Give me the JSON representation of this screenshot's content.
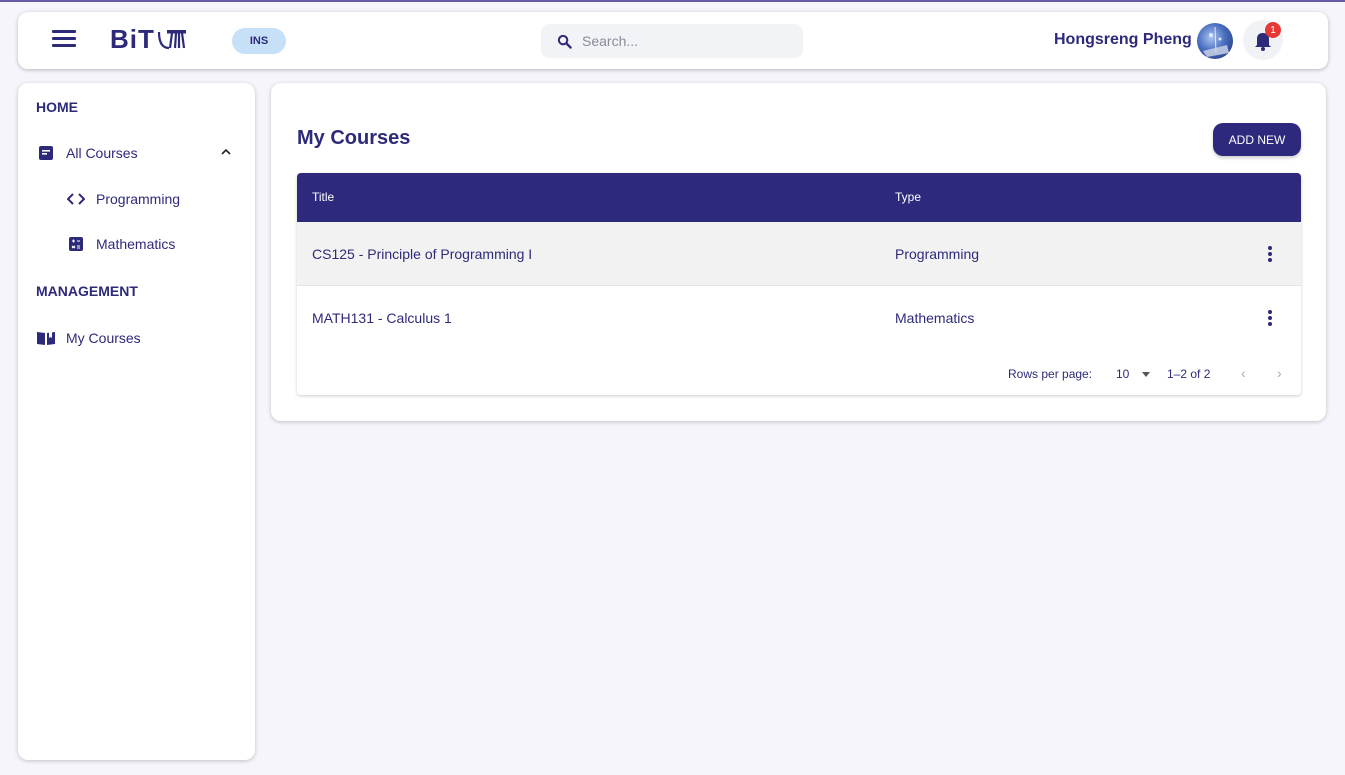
{
  "header": {
    "logo_text": "BiT",
    "role_badge": "INS",
    "search_placeholder": "Search...",
    "username": "Hongsreng Pheng",
    "notification_count": "1"
  },
  "sidebar": {
    "home_heading": "HOME",
    "all_courses_label": "All Courses",
    "sub_items": [
      {
        "label": "Programming",
        "icon": "code-icon"
      },
      {
        "label": "Mathematics",
        "icon": "calculator-icon"
      }
    ],
    "management_heading": "MANAGEMENT",
    "my_courses_label": "My Courses"
  },
  "main": {
    "title": "My Courses",
    "add_button": "ADD NEW",
    "columns": [
      "Title",
      "Type"
    ],
    "rows": [
      {
        "title": "CS125 - Principle of Programming I",
        "type": "Programming"
      },
      {
        "title": "MATH131 - Calculus 1",
        "type": "Mathematics"
      }
    ],
    "pagination": {
      "rows_per_page_label": "Rows per page:",
      "rows_per_page_value": "10",
      "range": "1–2 of 2"
    }
  },
  "colors": {
    "primary": "#2d2a7e",
    "badge_bg": "#c6e0f7",
    "notification": "#e53935",
    "background": "#f5f5fb"
  }
}
